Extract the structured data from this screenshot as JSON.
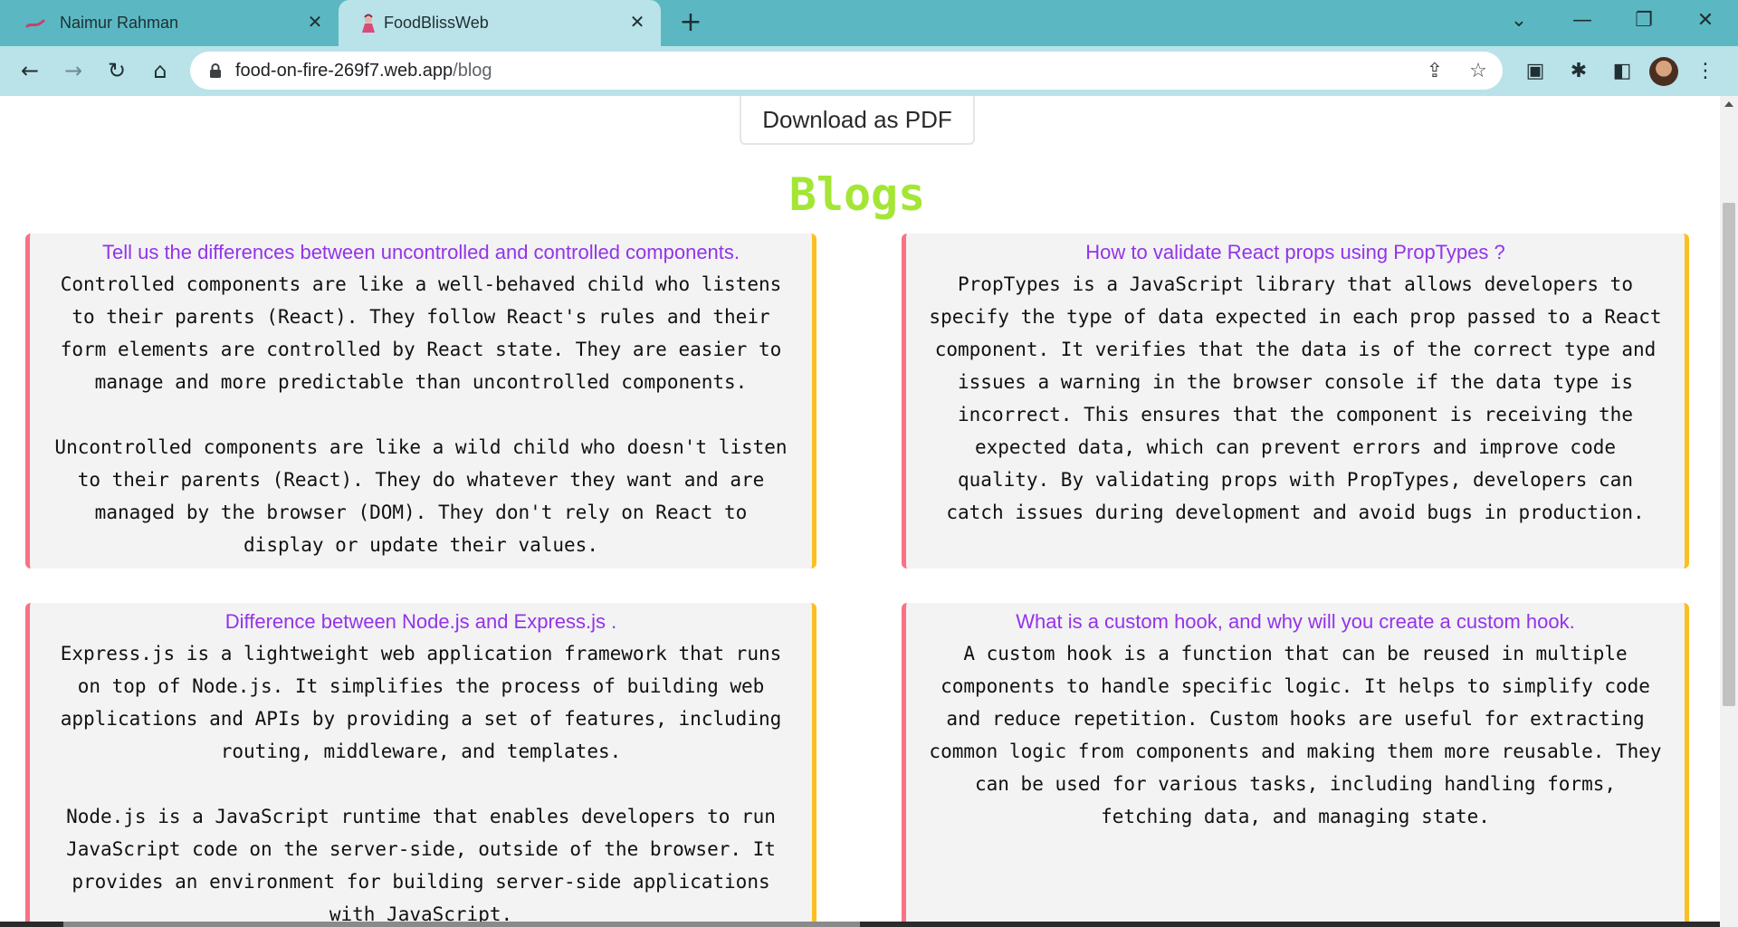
{
  "browser": {
    "tabs": [
      {
        "title": "Naimur Rahman",
        "active": false,
        "favicon": "ink-brush-icon"
      },
      {
        "title": "FoodBlissWeb",
        "active": true,
        "favicon": "chef-icon"
      }
    ],
    "address": {
      "host": "food-on-fire-269f7.web.app",
      "path": "/blog"
    },
    "colors": {
      "tabstrip": "#5bb8c2",
      "toolbar": "#b9e3e8"
    }
  },
  "page": {
    "download_label": "Download as PDF",
    "title": "Blogs",
    "title_color": "#a3e635",
    "question_color": "#9333ea",
    "cards": [
      {
        "question": "Tell us the differences between uncontrolled and controlled components.",
        "answer": "Controlled components are like a well-behaved child who listens\nto their parents (React). They follow React's rules and their\nform elements are controlled by React state. They are easier to\nmanage and more predictable than uncontrolled components.\n\nUncontrolled components are like a wild child who doesn't listen\nto their parents (React). They do whatever they want and are\nmanaged by the browser (DOM). They don't rely on React to\ndisplay or update their values."
      },
      {
        "question": "How to validate React props using PropTypes ?",
        "answer": "PropTypes is a JavaScript library that allows developers to\nspecify the type of data expected in each prop passed to a React\ncomponent. It verifies that the data is of the correct type and\nissues a warning in the browser console if the data type is\nincorrect. This ensures that the component is receiving the\nexpected data, which can prevent errors and improve code\nquality. By validating props with PropTypes, developers can\ncatch issues during development and avoid bugs in production."
      },
      {
        "question": "Difference between Node.js and Express.js .",
        "answer": "Express.js is a lightweight web application framework that runs\non top of Node.js. It simplifies the process of building web\napplications and APIs by providing a set of features, including\nrouting, middleware, and templates.\n\nNode.js is a JavaScript runtime that enables developers to run\nJavaScript code on the server-side, outside of the browser. It\nprovides an environment for building server-side applications\nwith JavaScript."
      },
      {
        "question": "What is a custom hook, and why will you create a custom hook.",
        "answer": "A custom hook is a function that can be reused in multiple\ncomponents to handle specific logic. It helps to simplify code\nand reduce repetition. Custom hooks are useful for extracting\ncommon logic from components and making them more reusable. They\ncan be used for various tasks, including handling forms,\nfetching data, and managing state."
      }
    ]
  }
}
